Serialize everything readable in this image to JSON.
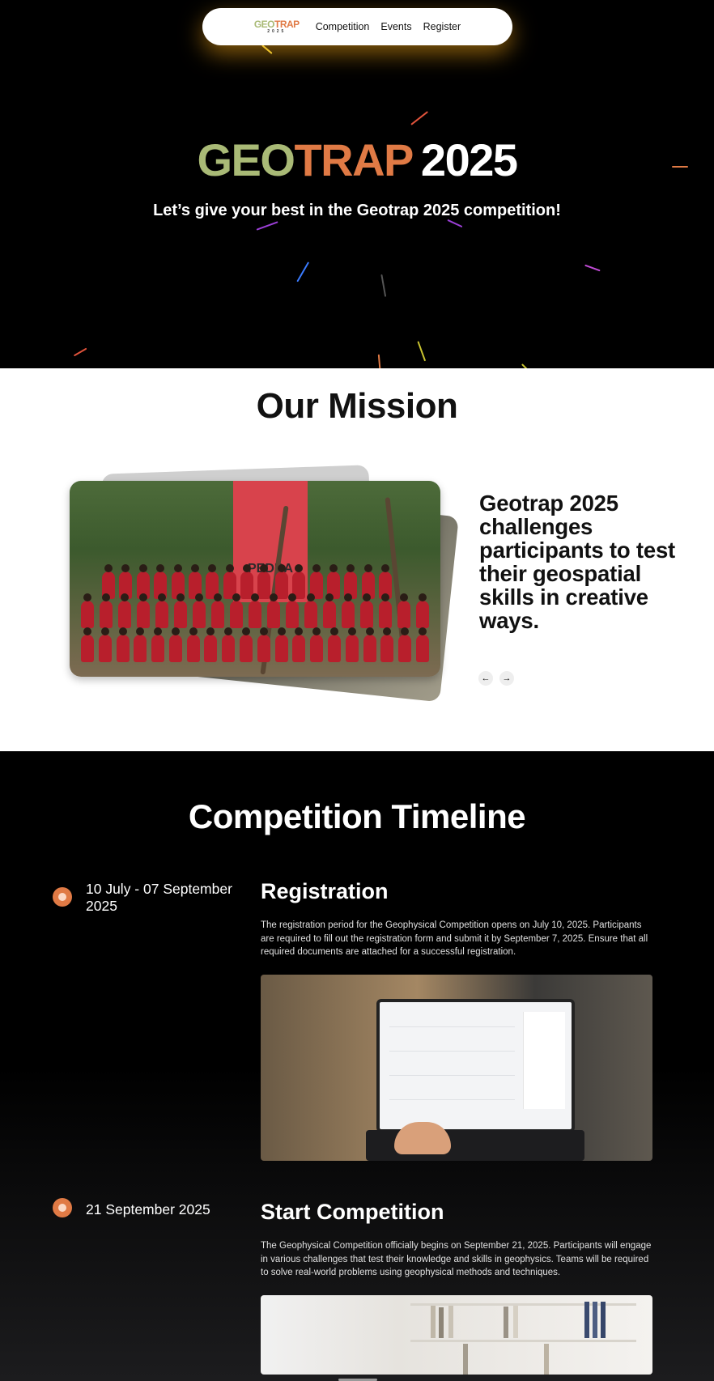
{
  "nav": {
    "logo_geo": "GEO",
    "logo_trap": "TRAP",
    "logo_sub": "2025",
    "links": [
      "Competition",
      "Events",
      "Register"
    ]
  },
  "hero": {
    "title_geo": "GEO",
    "title_trap": "TRAP",
    "title_year": "2025",
    "subtitle": "Let’s give your best in the Geotrap 2025 competition!"
  },
  "mission": {
    "title": "Our Mission",
    "banner_text": "PEDRA",
    "statement": "Geotrap 2025 challenges participants to test their geospatial skills in creative ways.",
    "prev_icon": "arrow-left-icon",
    "next_icon": "arrow-right-icon"
  },
  "timeline": {
    "title": "Competition Timeline",
    "items": [
      {
        "date": "10 July - 07 September 2025",
        "heading": "Registration",
        "description": "The registration period for the Geophysical Competition opens on July 10, 2025. Participants are required to fill out the registration form and submit it by September 7, 2025. Ensure that all required documents are attached for a successful registration."
      },
      {
        "date": "21 September 2025",
        "heading": "Start Competition",
        "description": "The Geophysical Competition officially begins on September 21, 2025. Participants will engage in various challenges that test their knowledge and skills in geophysics. Teams will be required to solve real-world problems using geophysical methods and techniques."
      }
    ]
  },
  "colors": {
    "accent_orange": "#e07a45",
    "accent_green": "#a9ba76",
    "nav_glow": "#f5a514"
  }
}
